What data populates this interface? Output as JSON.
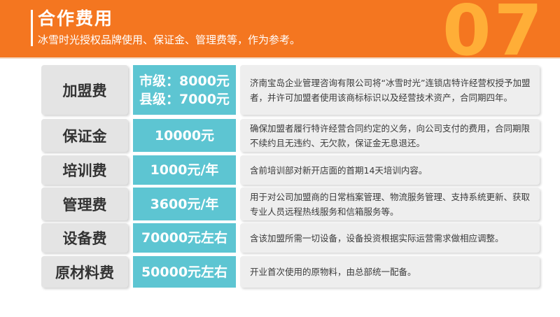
{
  "header": {
    "title": "合作费用",
    "subtitle": "冰雪时光授权品牌使用、保证金、管理费等，作为参考。",
    "number": "07"
  },
  "colors": {
    "header_bg": "#f47620",
    "header_number": "#ffae37",
    "value_bg": "#5dc5d2",
    "name_bg": "#e4e4e4",
    "desc_bg": "#eeeeee"
  },
  "fees": [
    {
      "name": "加盟费",
      "value_lines": [
        "市级：8000元",
        "县级：7000元"
      ],
      "description": "济南宝岛企业管理咨询有限公司将“冰雪时光”连锁店特许经营权授予加盟者，并许可加盟者使用该商标标识以及经营技术资产，合同期四年。"
    },
    {
      "name": "保证金",
      "value_lines": [
        "10000元"
      ],
      "description": "确保加盟者履行特许经营合同约定的义务，向公司支付的费用，合同期限不续约且无违约、无欠款，保证金无息退还。"
    },
    {
      "name": "培训费",
      "value_lines": [
        "1000元/年"
      ],
      "description": "含前培训部对新开店面的首期14天培训内容。"
    },
    {
      "name": "管理费",
      "value_lines": [
        "3600元/年"
      ],
      "description": "用于对公司加盟商的日常档案管理、物流服务管理、支持系统更新、获取专业人员远程热线服务和信箱服务等。"
    },
    {
      "name": "设备费",
      "value_lines": [
        "70000元左右"
      ],
      "description": "含该加盟所需一切设备，设备投资根据实际运营需求做相应调整。"
    },
    {
      "name": "原材料费",
      "value_lines": [
        "50000元左右"
      ],
      "description": "开业首次使用的原物料，由总部统一配备。"
    }
  ]
}
